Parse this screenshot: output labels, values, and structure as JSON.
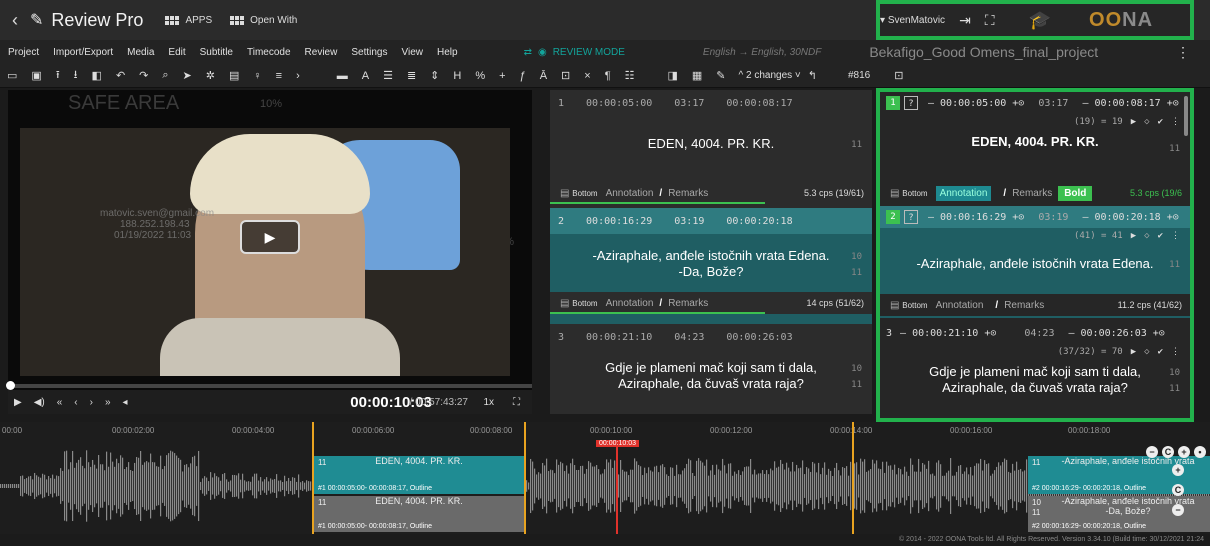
{
  "topbar": {
    "back": "‹",
    "title": "Review Pro",
    "apps_label": "APPS",
    "open_with_label": "Open With",
    "user": "SvenMatovic",
    "brand_oo": "OO",
    "brand_na": "NA"
  },
  "menu": {
    "items": [
      "Project",
      "Import/Export",
      "Media",
      "Edit",
      "Subtitle",
      "Timecode",
      "Review",
      "Settings",
      "View",
      "Help"
    ],
    "review_mode": "REVIEW MODE",
    "language": "English → English, 30NDF",
    "project_name": "Bekafigo_Good Omens_final_project"
  },
  "toolbar": {
    "changes": "2 changes",
    "number": "#816"
  },
  "video": {
    "safe_area": "SAFE AREA",
    "pct": "10%",
    "watermark_1": "matovic.sven@gmail.com",
    "watermark_2": "188.252.198.43",
    "watermark_3": "01/19/2022 11:03",
    "timecode": "00:00:10:03",
    "duration": "/ 00:57:43:27",
    "speed": "1x"
  },
  "subtitles": [
    {
      "index": "1",
      "tc_in": "00:00:05:00",
      "duration": "03:17",
      "tc_out": "00:00:08:17",
      "line1": "EDEN, 4004. PR. KR.",
      "line2": "",
      "count1": "11",
      "count2": "",
      "position": "Bottom",
      "annotation": "Annotation",
      "remarks": "Remarks",
      "cps": "5.3 cps (19/61)"
    },
    {
      "index": "2",
      "tc_in": "00:00:16:29",
      "duration": "03:19",
      "tc_out": "00:00:20:18",
      "line1": "-Aziraphale, anđele istočnih vrata Edena.",
      "line2": "-Da, Bože?",
      "count1": "10",
      "count2": "11",
      "position": "Bottom",
      "annotation": "Annotation",
      "remarks": "Remarks",
      "cps": "14 cps (51/62)"
    },
    {
      "index": "3",
      "tc_in": "00:00:21:10",
      "duration": "04:23",
      "tc_out": "00:00:26:03",
      "line1": "Gdje je plameni mač koji sam ti dala,",
      "line2": "Aziraphale, da čuvaš vrata raja?",
      "count1": "10",
      "count2": "11",
      "position": "Bottom",
      "annotation": "Annotation",
      "remarks": "Remarks",
      "cps": ""
    }
  ],
  "review": [
    {
      "index": "1",
      "q": "?",
      "tc_in": "— 00:00:05:00 +⊙",
      "duration": "03:17",
      "tc_out": "— 00:00:08:17 +⊙",
      "sub": "(19) = 19",
      "line1": "EDEN, 4004. PR. KR.",
      "line2": "",
      "count1": "11",
      "count2": "",
      "position": "Bottom",
      "annotation": "Annotation",
      "remarks": "Remarks",
      "bold": "Bold",
      "cps": "5.3 cps (19/6"
    },
    {
      "index": "2",
      "q": "?",
      "tc_in": "— 00:00:16:29 +⊙",
      "duration": "03:19",
      "tc_out": "— 00:00:20:18 +⊙",
      "sub": "(41) = 41",
      "line1": "-Aziraphale, anđele istočnih vrata Edena.",
      "line2": "",
      "count1": "11",
      "count2": "",
      "position": "Bottom",
      "annotation": "Annotation",
      "remarks": "Remarks",
      "bold": "",
      "cps": "11.2 cps (41/62)"
    },
    {
      "index": "3",
      "q": "",
      "tc_in": "— 00:00:21:10 +⊙",
      "duration": "04:23",
      "tc_out": "— 00:00:26:03 +⊙",
      "sub": "(37/32) = 70",
      "line1": "Gdje je plameni mač koji sam ti dala,",
      "line2": "Aziraphale, da čuvaš vrata raja?",
      "count1": "10",
      "count2": "11",
      "position": "",
      "annotation": "",
      "remarks": "",
      "bold": "",
      "cps": ""
    }
  ],
  "timeline": {
    "ticks": [
      "00:00",
      "00:00:02:00",
      "00:00:04:00",
      "00:00:06:00",
      "00:00:08:00",
      "00:00:10:00",
      "00:00:12:00",
      "00:00:14:00",
      "00:00:16:00",
      "00:00:18:00"
    ],
    "playhead": "00:00:10:03",
    "seg1_text": "EDEN, 4004. PR. KR.",
    "seg1_num": "11",
    "seg1_info": "#1 00:00:05:00- 00:00:08:17, Outline",
    "seg2_text": "EDEN, 4004. PR. KR.",
    "seg2_num": "11",
    "seg2_info": "#1 00:00:05:00- 00:00:08:17, Outline",
    "seg3_text": "-Aziraphale, anđele istočnih vrata",
    "seg3_num": "11",
    "seg3_info": "#2 00:00:16:29- 00:00:20:18, Outline",
    "seg4_text": "-Aziraphale, anđele istočnih vrata",
    "seg4_text2": "-Da, Bože?",
    "seg4_num": "10",
    "seg4_num2": "11",
    "seg4_info": "#2 00:00:16:29- 00:00:20:18, Outline"
  },
  "footer": "© 2014 - 2022 OONA Tools ltd. All Rights Reserved. Version 3.34.10 (Build time: 30/12/2021 21:24"
}
